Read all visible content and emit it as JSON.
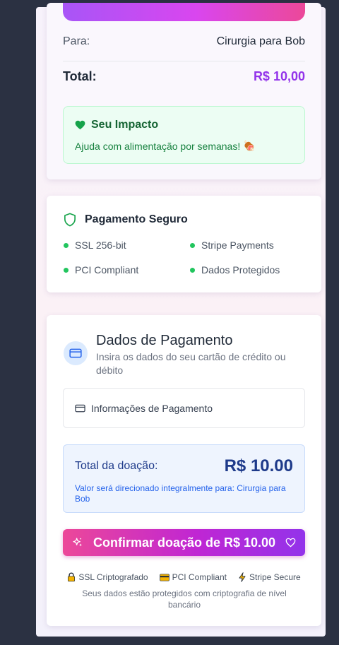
{
  "summary": {
    "para_label": "Para:",
    "para_value": "Cirurgia para Bob",
    "total_label": "Total:",
    "total_value": "R$ 10,00",
    "impact_title": "Seu Impacto",
    "impact_text": "Ajuda com alimentação por semanas!",
    "impact_emoji": "🍖"
  },
  "security": {
    "title": "Pagamento Seguro",
    "items": [
      "SSL 256-bit",
      "Stripe Payments",
      "PCI Compliant",
      "Dados Protegidos"
    ]
  },
  "payment": {
    "title": "Dados de Pagamento",
    "subtitle": "Insira os dados do seu cartão de crédito ou débito",
    "info_label": "Informações de Pagamento",
    "total_label": "Total da doação:",
    "total_value": "R$ 10.00",
    "total_note": "Valor será direcionado integralmente para: Cirurgia para Bob",
    "confirm_label": "Confirmar doação de R$ 10.00",
    "badges": [
      "SSL Criptografado",
      "PCI Compliant",
      "Stripe Secure"
    ],
    "footer_note": "Seus dados estão protegidos com criptografia de nível bancário"
  },
  "icons": {
    "heart": "heart-icon",
    "shield": "shield-icon",
    "card": "credit-card-icon",
    "sparkles": "sparkles-icon",
    "lock": "lock-icon",
    "bolt": "bolt-icon"
  },
  "colors": {
    "background": "#2b3142",
    "accent_purple": "#9333ea",
    "accent_pink": "#ec4899",
    "success_green": "#22c55e",
    "info_blue": "#1e3a8a"
  }
}
